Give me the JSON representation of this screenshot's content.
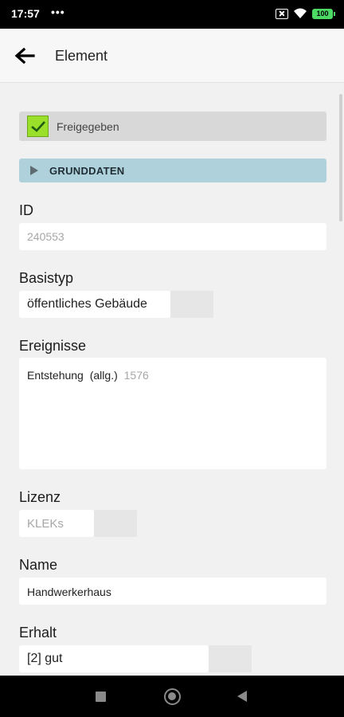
{
  "status_bar": {
    "time": "17:57",
    "dots": "•••",
    "battery": "100",
    "icons": [
      "sim-icon",
      "wifi-icon",
      "battery-icon"
    ]
  },
  "app_bar": {
    "title": "Element",
    "back_icon": "arrow-left-icon"
  },
  "release": {
    "label": "Freigegeben",
    "checked": true,
    "check_color": "#9ae02a"
  },
  "section": {
    "label": "GRUNDDATEN",
    "color": "#afd1dc"
  },
  "fields": {
    "id": {
      "label": "ID",
      "value": "240553"
    },
    "basistyp": {
      "label": "Basistyp",
      "value": "öffentliches Gebäude"
    },
    "ereignisse": {
      "label": "Ereignisse",
      "event_name": "Entstehung",
      "event_qualifier": "(allg.)",
      "event_year": "1576"
    },
    "lizenz": {
      "label": "Lizenz",
      "value": "KLEKs"
    },
    "name": {
      "label": "Name",
      "value": "Handwerkerhaus"
    },
    "erhalt": {
      "label": "Erhalt",
      "value": "[2] gut"
    }
  },
  "nav_bar": {
    "icons": [
      "recents-icon",
      "home-icon",
      "back-icon"
    ]
  }
}
